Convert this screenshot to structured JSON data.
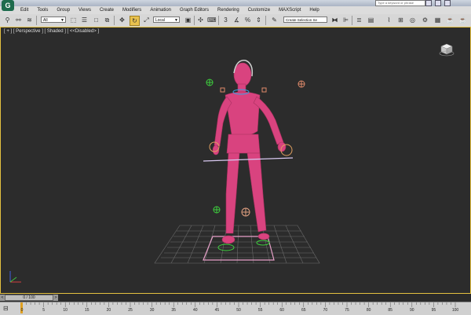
{
  "titlebar": {
    "logo": "G",
    "search_placeholder": "Type a keyword or phrase"
  },
  "menu": [
    "Edit",
    "Tools",
    "Group",
    "Views",
    "Create",
    "Modifiers",
    "Animation",
    "Graph Editors",
    "Rendering",
    "Customize",
    "MAXScript",
    "Help"
  ],
  "toolbar": {
    "selection_filter": "All",
    "coord_system": "Local",
    "snap_label": "3",
    "percent_snap_label": "%",
    "selection_set": "Create Selection Se"
  },
  "viewport": {
    "label": "[ + ] [ Perspective ] [ Shaded ] [ <<Disabled> ]"
  },
  "timeline": {
    "frame_counter": "0 / 100",
    "prev_symbol": "<",
    "next_symbol": ">",
    "ticks": [
      "0",
      "5",
      "10",
      "15",
      "20",
      "25",
      "30",
      "35",
      "40",
      "45",
      "50",
      "55",
      "60",
      "65",
      "70",
      "75",
      "80",
      "85",
      "90",
      "95",
      "100"
    ]
  },
  "icons": {
    "character": "biped-figure",
    "accent_color": "#e4c040",
    "figure_color": "#d9437f"
  }
}
